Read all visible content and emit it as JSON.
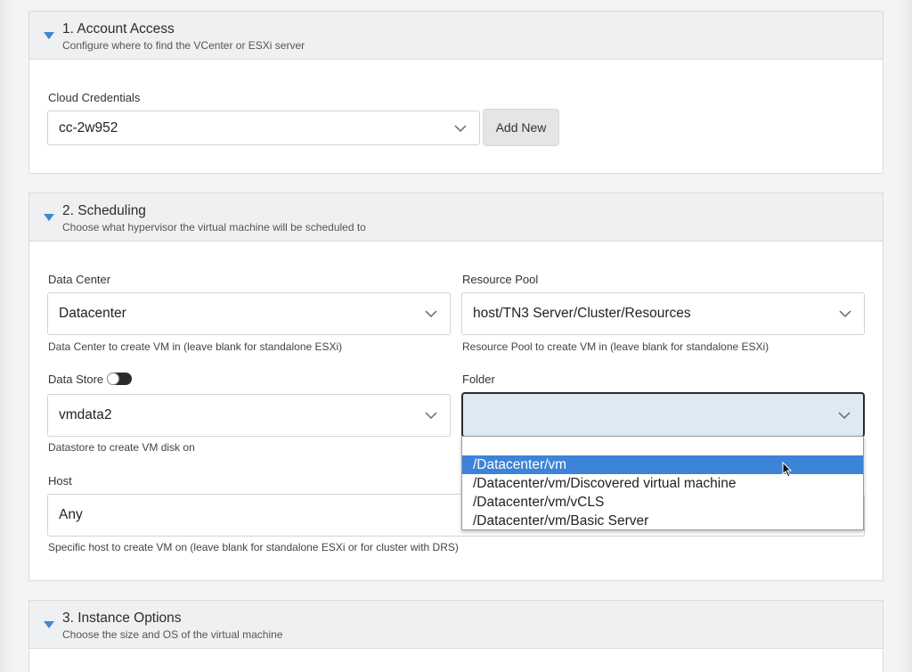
{
  "sections": [
    {
      "title": "1. Account Access",
      "subtitle": "Configure where to find the VCenter or ESXi server"
    },
    {
      "title": "2. Scheduling",
      "subtitle": "Choose what hypervisor the virtual machine will be scheduled to"
    },
    {
      "title": "3. Instance Options",
      "subtitle": "Choose the size and OS of the virtual machine"
    }
  ],
  "account": {
    "cloud_credentials_label": "Cloud Credentials",
    "cloud_credentials_value": "cc-2w952",
    "add_new_label": "Add New"
  },
  "scheduling": {
    "data_center": {
      "label": "Data Center",
      "value": "Datacenter",
      "help": "Data Center to create VM in (leave blank for standalone ESXi)"
    },
    "resource_pool": {
      "label": "Resource Pool",
      "value": "host/TN3 Server/Cluster/Resources",
      "help": "Resource Pool to create VM in (leave blank for standalone ESXi)"
    },
    "data_store": {
      "label": "Data Store",
      "value": "vmdata2",
      "help": "Datastore to create VM disk on",
      "toggle_on": false
    },
    "folder": {
      "label": "Folder",
      "value": ""
    },
    "host": {
      "label": "Host",
      "value": "Any",
      "help": "Specific host to create VM on (leave blank for standalone ESXi or for cluster with DRS)"
    }
  },
  "folder_dropdown": {
    "options": [
      "",
      "/Datacenter/vm",
      "/Datacenter/vm/Discovered virtual machine",
      "/Datacenter/vm/vCLS",
      "/Datacenter/vm/Basic Server"
    ],
    "highlighted": "/Datacenter/vm"
  },
  "icons": {
    "caret": "caret-down-icon",
    "chevron": "chevron-down-icon",
    "cursor": "mouse-pointer-icon"
  },
  "colors": {
    "accent": "#3d83d8",
    "focused_bg": "#dde9f3"
  }
}
